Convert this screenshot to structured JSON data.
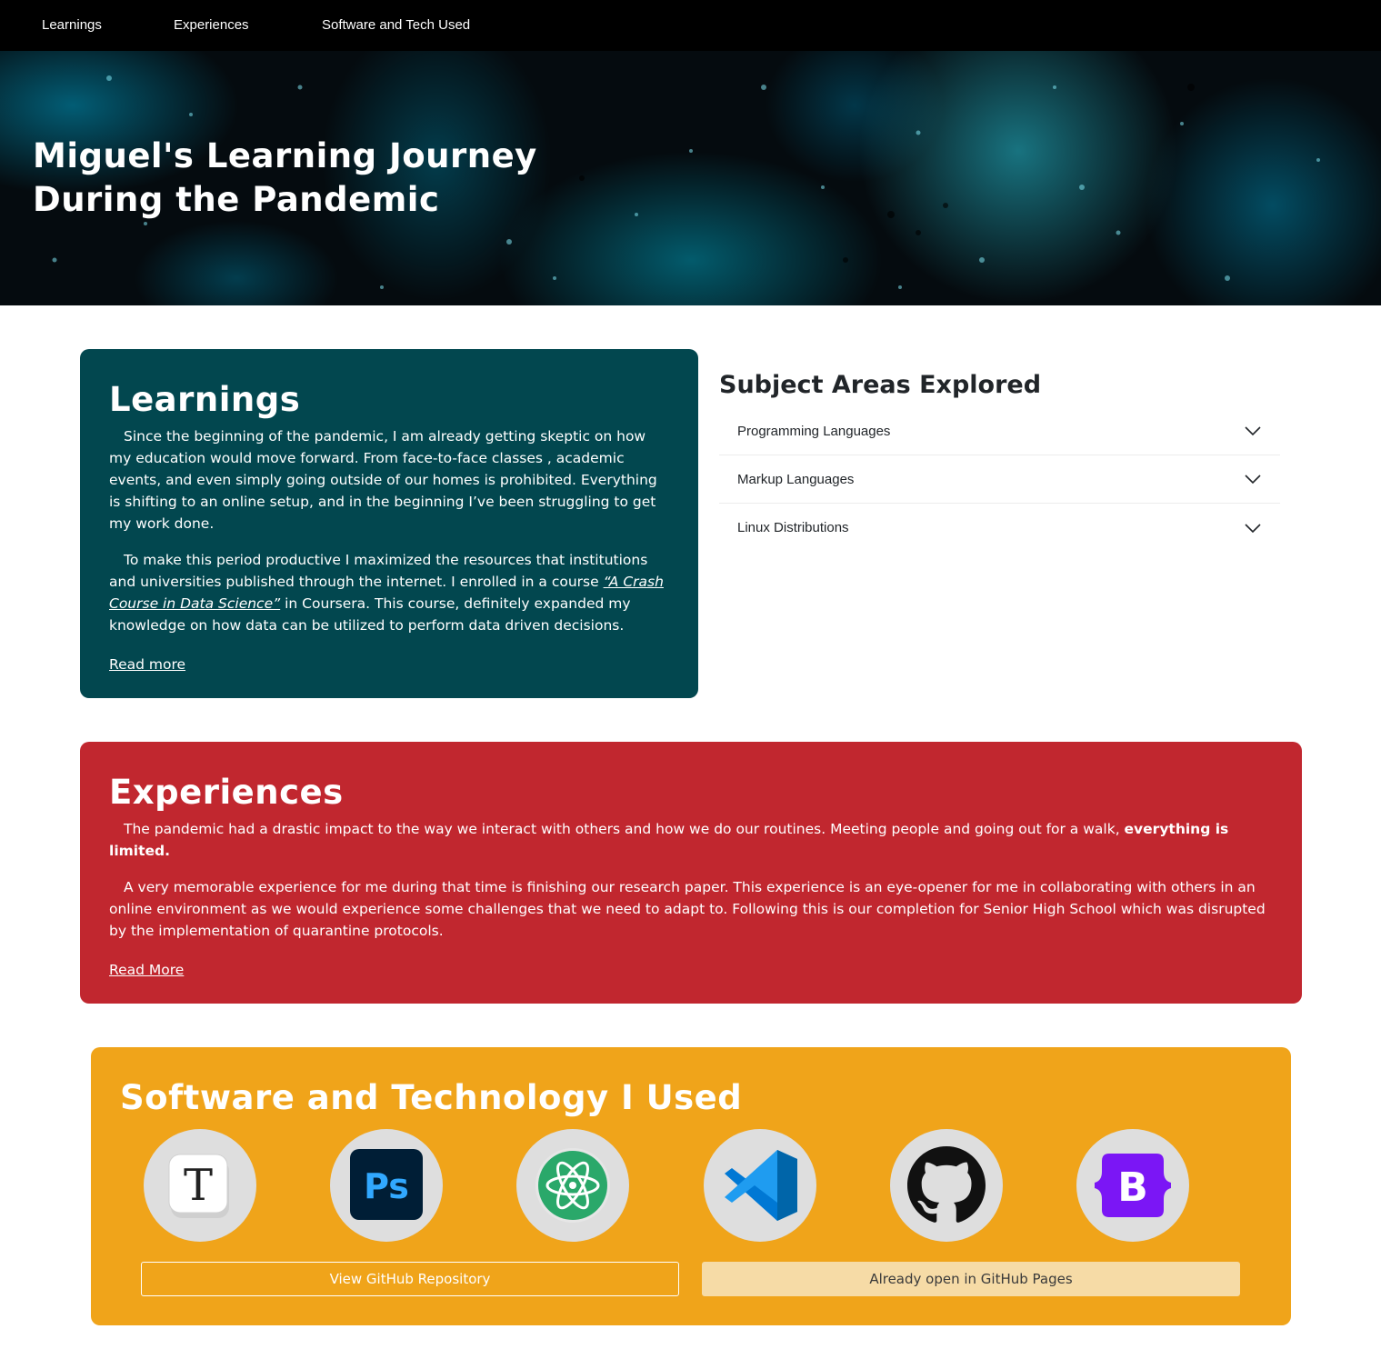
{
  "nav": {
    "items": [
      "Learnings",
      "Experiences",
      "Software and Tech Used"
    ]
  },
  "hero": {
    "title": "Miguel's Learning Journey During the Pandemic"
  },
  "learnings": {
    "title": "Learnings",
    "paragraph1": "Since the beginning of the pandemic, I am already getting skeptic on how my education would move forward. From face-to-face classes , academic events, and even simply going outside of our homes is prohibited. Everything is shifting to an online setup, and in the beginning I’ve been struggling to get my work done.",
    "paragraph2_before": "To make this period productive I maximized the resources that institutions and universities published through the internet. I enrolled in a course ",
    "paragraph2_link": "“A Crash Course in Data Science”",
    "paragraph2_after": "  in Coursera. This course, definitely expanded my knowledge on how data can be utilized to perform data driven decisions.",
    "read_more": "Read more"
  },
  "subjects": {
    "title": "Subject Areas Explored",
    "items": [
      "Programming Languages",
      "Markup Languages",
      "Linux Distributions"
    ]
  },
  "experiences": {
    "title": "Experiences",
    "paragraph1_before": "The pandemic had a drastic impact to the way we interact with others and how we do our routines. Meeting people and going out for a walk, ",
    "paragraph1_bold": "everything is limited.",
    "paragraph2": "A very memorable experience for me during that time is finishing our research paper. This experience is an eye-opener for me in collaborating with others in an online environment as we would experience some challenges that we need to adapt to. Following this is our completion for Senior High School which was disrupted by the implementation of quarantine protocols.",
    "read_more": "Read More"
  },
  "software": {
    "title": "Software and Technology I Used",
    "tools": [
      {
        "icon": "typora-icon",
        "glyph": "T"
      },
      {
        "icon": "photoshop-icon",
        "glyph": "Ps"
      },
      {
        "icon": "atom-icon"
      },
      {
        "icon": "vscode-icon"
      },
      {
        "icon": "github-icon"
      },
      {
        "icon": "bootstrap-icon",
        "glyph": "B"
      }
    ],
    "btn_repo": "View GitHub Repository",
    "btn_pages": "Already open in GitHub Pages"
  },
  "colors": {
    "learnings_bg": "#02474f",
    "experiences_bg": "#c1272f",
    "software_bg": "#f0a41a",
    "nav_bg": "#000000"
  }
}
